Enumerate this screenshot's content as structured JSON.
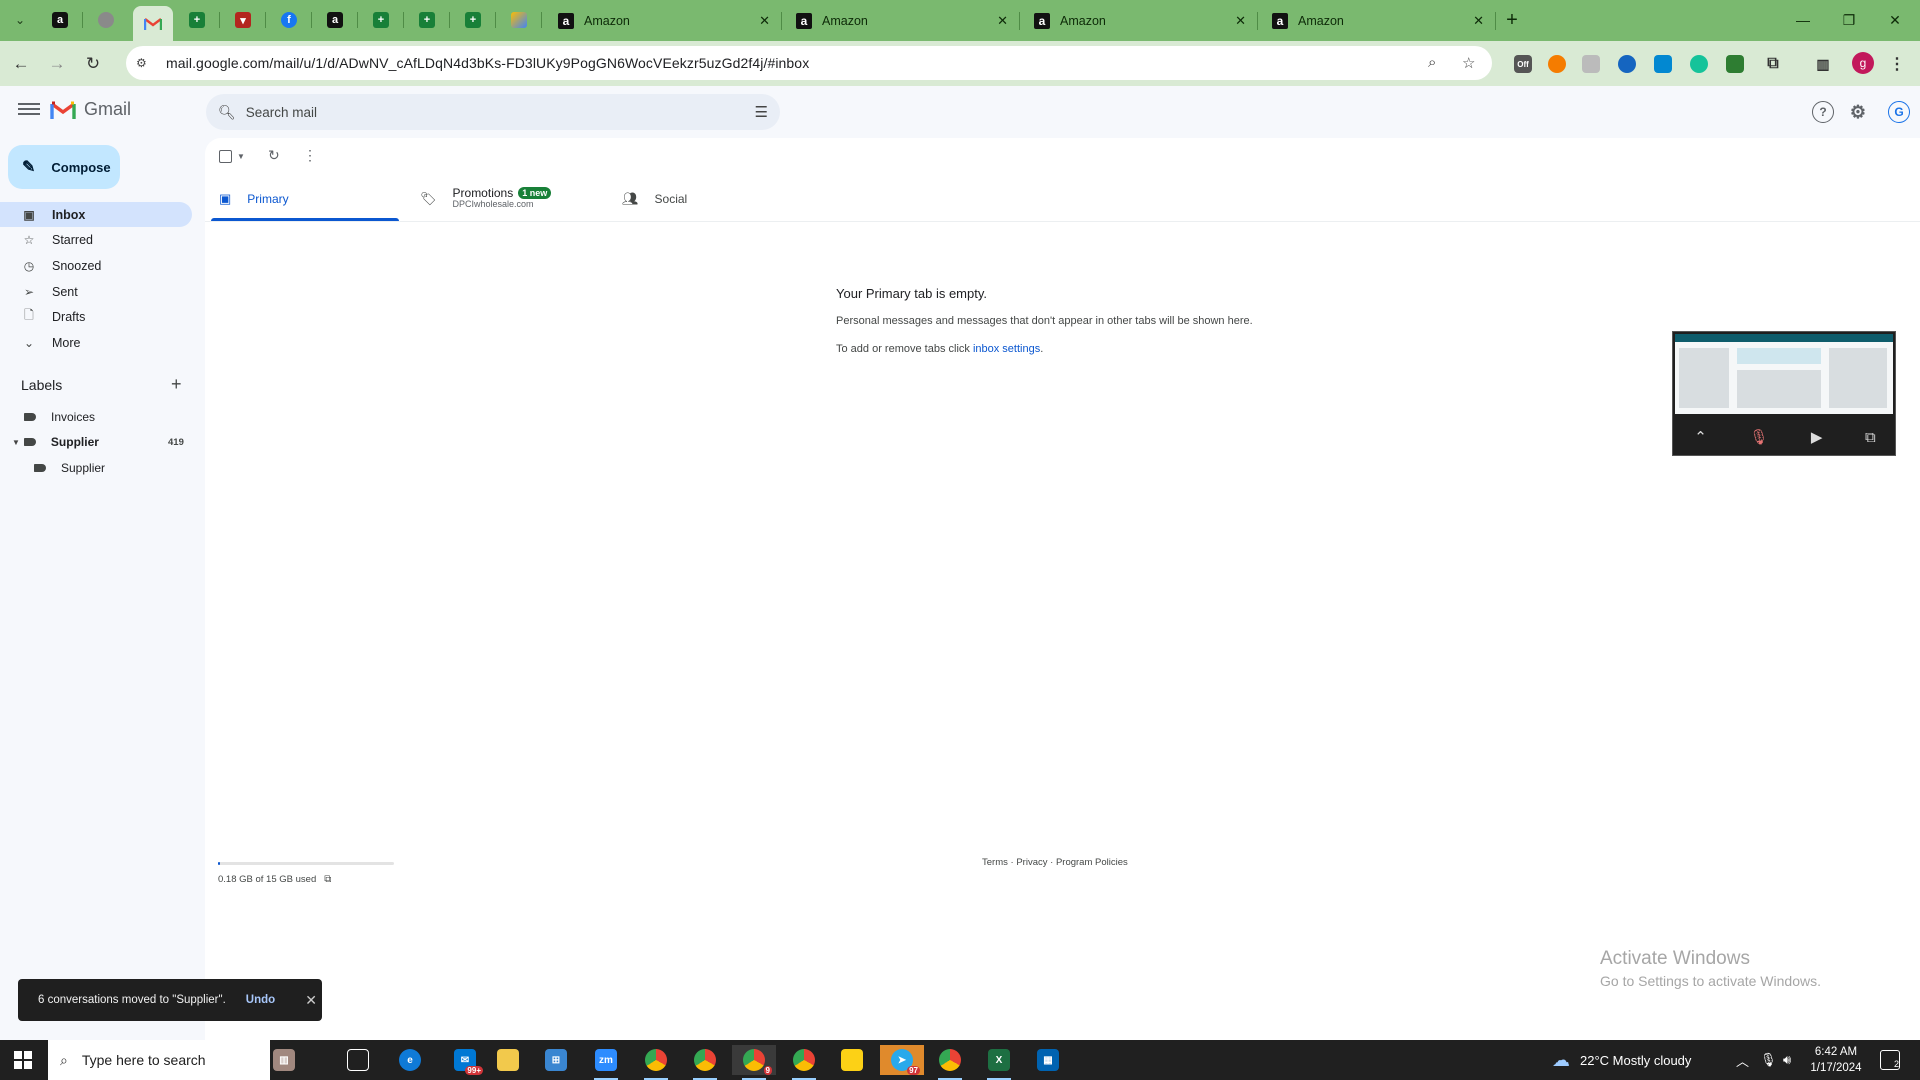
{
  "browser": {
    "tabs": [
      {
        "title": "Amazon"
      },
      {
        "title": "Amazon"
      },
      {
        "title": "Amazon"
      },
      {
        "title": "Amazon"
      }
    ],
    "url": "mail.google.com/mail/u/1/d/ADwNV_cAfLDqN4d3bKs-FD3lUKy9PogGN6WocVEekzr5uzGd2f4j/#inbox",
    "profile_initial": "g",
    "extension_badge": "Off",
    "colors": {
      "frame": "#7ab96f",
      "toolbar": "#d9ead4"
    }
  },
  "gmail": {
    "wordmark": "Gmail",
    "search_placeholder": "Search mail",
    "compose_label": "Compose",
    "nav": [
      {
        "label": "Inbox",
        "icon": "inbox-icon"
      },
      {
        "label": "Starred",
        "icon": "star-icon"
      },
      {
        "label": "Snoozed",
        "icon": "clock-icon"
      },
      {
        "label": "Sent",
        "icon": "send-icon"
      },
      {
        "label": "Drafts",
        "icon": "draft-icon"
      },
      {
        "label": "More",
        "icon": "chevron-down-icon"
      }
    ],
    "labels_heading": "Labels",
    "labels": [
      {
        "name": "Invoices",
        "count": ""
      },
      {
        "name": "Supplier",
        "count": "419"
      },
      {
        "name": "Supplier",
        "count": ""
      }
    ],
    "category_tabs": [
      {
        "label": "Primary",
        "icon": "inbox-icon"
      },
      {
        "label": "Promotions",
        "icon": "tag-icon",
        "badge": "1 new",
        "subtitle": "DPCIwholesale.com"
      },
      {
        "label": "Social",
        "icon": "people-icon"
      }
    ],
    "empty_state": {
      "title": "Your Primary tab is empty.",
      "line1": "Personal messages and messages that don't appear in other tabs will be shown here.",
      "line2_prefix": "To add or remove tabs click ",
      "line2_link": "inbox settings",
      "line2_suffix": "."
    },
    "storage": {
      "text": "0.18 GB of 15 GB used",
      "fraction": 0.012
    },
    "footer": {
      "terms": "Terms",
      "privacy": "Privacy",
      "policies": "Program Policies",
      "sep": " · "
    },
    "snackbar": {
      "message": "6 conversations moved to \"Supplier\".",
      "action": "Undo"
    }
  },
  "watermark": {
    "line1": "Activate Windows",
    "line2": "Go to Settings to activate Windows."
  },
  "taskbar": {
    "search_placeholder": "Type here to search",
    "weather": "22°C  Mostly cloudy",
    "time": "6:42 AM",
    "date": "1/17/2024",
    "notification_count": "2",
    "mail_badge": "99+",
    "chrome_badge": "9",
    "telegram_badge": "97"
  }
}
